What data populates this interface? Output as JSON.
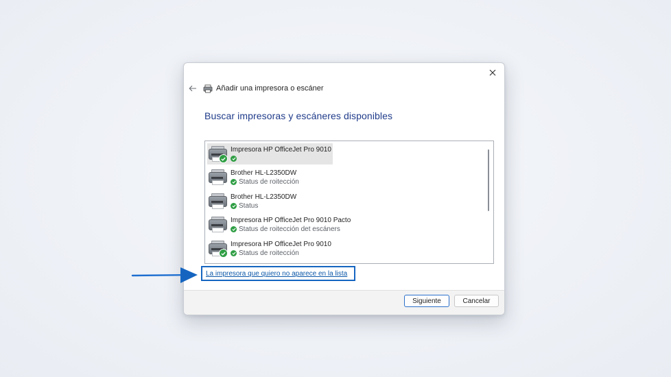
{
  "window": {
    "title": "Añadir una impresora o escáner",
    "icons": {
      "close": "close-icon",
      "back": "back-arrow-icon",
      "title": "printer-icon"
    }
  },
  "main": {
    "heading": "Buscar impresoras y escáneres disponibles",
    "printers": [
      {
        "name": "Impresora HP OfficeJet Pro 9010",
        "status": "",
        "selected": true,
        "badge": true
      },
      {
        "name": "Brother HL-L2350DW",
        "status": "Status de roitección",
        "selected": false,
        "badge": false
      },
      {
        "name": "Brother HL-L2350DW",
        "status": "Status",
        "selected": false,
        "badge": false
      },
      {
        "name": "Impresora HP OfficeJet Pro 9010 Pacto",
        "status": "Status de roitección det escáners",
        "selected": false,
        "badge": false
      },
      {
        "name": "Impresora HP OfficeJet Pro 9010",
        "status": "Status de roitección",
        "selected": false,
        "badge": true
      }
    ],
    "link": "La impresora que quiero no aparece en la lista"
  },
  "footer": {
    "next_label": "Siguiente",
    "cancel_label": "Cancelar"
  },
  "colors": {
    "accent": "#1565c0",
    "heading": "#1f3b8a",
    "status_ok": "#2f9e44"
  }
}
